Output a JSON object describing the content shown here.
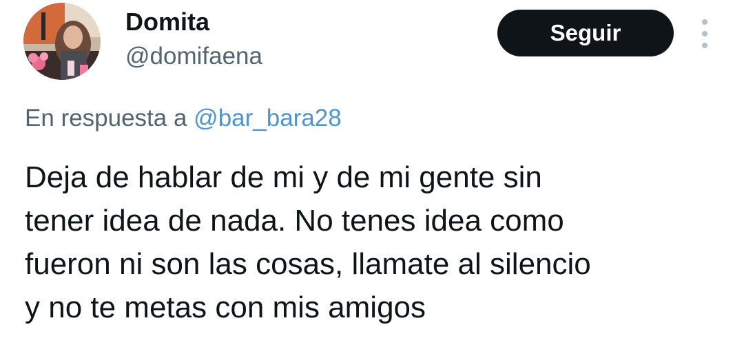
{
  "author": {
    "display_name": "Domita",
    "handle": "@domifaena"
  },
  "actions": {
    "follow_label": "Seguir"
  },
  "reply": {
    "prefix": "En respuesta a",
    "mention": "@bar_bara28"
  },
  "tweet": {
    "lines": [
      "Deja de hablar de mi y de mi gente sin",
      "tener idea de nada. No tenes idea como",
      "fueron ni son las cosas, llamate al silencio",
      "y no te metas con mis amigos"
    ]
  },
  "colors": {
    "text_primary": "#0f1419",
    "text_secondary": "#536471",
    "link": "#4f94cf",
    "button_bg": "#0f1419",
    "button_text": "#ffffff"
  },
  "icons": {
    "more": "more-options-vertical-icon"
  }
}
